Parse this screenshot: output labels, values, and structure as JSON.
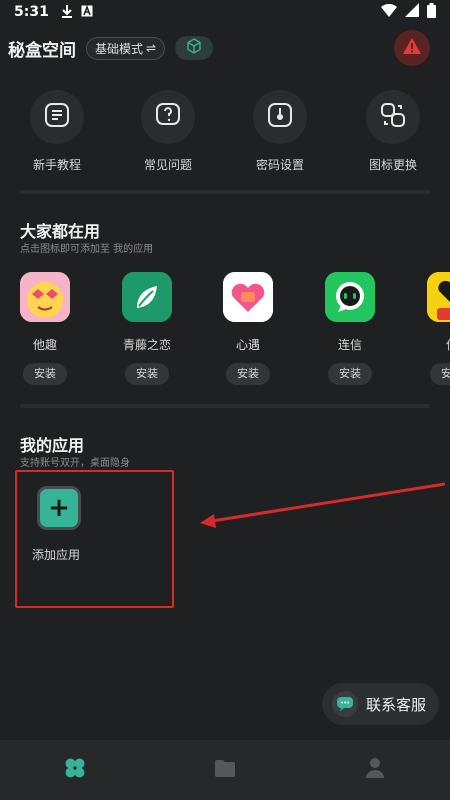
{
  "status": {
    "time": "5:31",
    "icons": [
      "download-icon",
      "a-badge-icon",
      "wifi-icon",
      "signal-icon",
      "battery-icon"
    ]
  },
  "header": {
    "title": "秘盒空间",
    "mode_label": "基础模式",
    "mode_switch_glyph": "⇌",
    "colors": {
      "alert_bg": "#5a2323",
      "alert_icon": "#e53935",
      "cube": "#36b596"
    }
  },
  "tools": [
    {
      "label": "新手教程",
      "icon": "tutorial-icon"
    },
    {
      "label": "常见问题",
      "icon": "faq-icon"
    },
    {
      "label": "密码设置",
      "icon": "password-icon"
    },
    {
      "label": "图标更换",
      "icon": "icon-change-icon"
    }
  ],
  "popular": {
    "title": "大家都在用",
    "subtitle": "点击图标即可添加至 我的应用",
    "apps": [
      {
        "name": "他趣",
        "install": "安装",
        "color": "#f7b4c8"
      },
      {
        "name": "青藤之恋",
        "install": "安装",
        "color": "#1e9a6a"
      },
      {
        "name": "心遇",
        "install": "安装",
        "color": "#ffffff"
      },
      {
        "name": "连信",
        "install": "安装",
        "color": "#22c55e"
      },
      {
        "name": "伊",
        "install": "安装",
        "color": "#f5d20f"
      }
    ]
  },
  "my_apps": {
    "title": "我的应用",
    "subtitle": "支持账号双开，桌面隐身",
    "add_label": "添加应用",
    "add_glyph": "+"
  },
  "service": {
    "label": "联系客服"
  },
  "nav": [
    {
      "name": "home",
      "icon": "clover-icon",
      "active": true
    },
    {
      "name": "files",
      "icon": "folder-icon",
      "active": false
    },
    {
      "name": "profile",
      "icon": "person-icon",
      "active": false
    }
  ]
}
